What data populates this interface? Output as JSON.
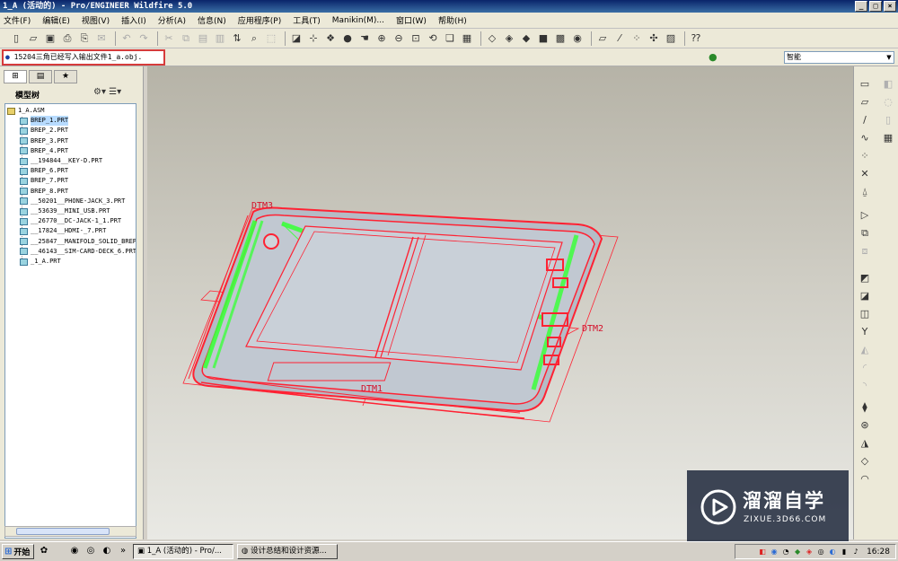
{
  "window": {
    "title": "1_A (活动的) - Pro/ENGINEER Wildfire 5.0",
    "controls": [
      "_",
      "□",
      "×"
    ]
  },
  "menu": [
    "文件(F)",
    "编辑(E)",
    "视图(V)",
    "插入(I)",
    "分析(A)",
    "信息(N)",
    "应用程序(P)",
    "工具(T)",
    "Manikin(M)...",
    "窗口(W)",
    "帮助(H)"
  ],
  "message": {
    "bullet": "●",
    "text": "15204三角已经写入输出文件1_a.obj."
  },
  "filter": {
    "value": "智能"
  },
  "panel": {
    "tabs": [
      "模型树",
      "文件夹",
      "收藏夹"
    ],
    "title": "模型树",
    "tree": [
      {
        "label": "1_A.ASM",
        "type": "asm",
        "level": 0
      },
      {
        "label": "BREP_1.PRT",
        "type": "prt",
        "level": 1,
        "selected": true
      },
      {
        "label": "BREP_2.PRT",
        "type": "prt",
        "level": 1
      },
      {
        "label": "BREP_3.PRT",
        "type": "prt",
        "level": 1
      },
      {
        "label": "BREP_4.PRT",
        "type": "prt",
        "level": 1
      },
      {
        "label": "__194844__KEY-D.PRT",
        "type": "prt",
        "level": 1
      },
      {
        "label": "BREP_6.PRT",
        "type": "prt",
        "level": 1
      },
      {
        "label": "BREP_7.PRT",
        "type": "prt",
        "level": 1
      },
      {
        "label": "BREP_8.PRT",
        "type": "prt",
        "level": 1
      },
      {
        "label": "__50201__PHONE-JACK_3.PRT",
        "type": "prt",
        "level": 1
      },
      {
        "label": "__53639__MINI_USB.PRT",
        "type": "prt",
        "level": 1
      },
      {
        "label": "__26770__DC-JACK-1_1.PRT",
        "type": "prt",
        "level": 1
      },
      {
        "label": "__17824__HDMI-_7.PRT",
        "type": "prt",
        "level": 1
      },
      {
        "label": "__25847__MANIFOLD_SOLID_BREP",
        "type": "prt",
        "level": 1
      },
      {
        "label": "__46143__SIM-CARD-DECK_6.PRT",
        "type": "prt",
        "level": 1
      },
      {
        "label": "_1_A.PRT",
        "type": "prt",
        "level": 1
      }
    ]
  },
  "viewport": {
    "datums": [
      "DTM3",
      "DTM2",
      "DTM1"
    ]
  },
  "watermark": {
    "main": "溜溜自学",
    "sub": "ZIXUE.3D66.COM"
  },
  "taskbar": {
    "start": "开始",
    "tasks": [
      "1_A (活动的) - Pro/...",
      "设计总结和设计资源..."
    ],
    "clock": "16:28"
  },
  "colors": {
    "accent_title": "#0a246a",
    "model_edge": "#ff2233",
    "model_fill": "#b6bec8",
    "model_green": "#3cff3c",
    "highlight_box": "#d63b3b"
  }
}
